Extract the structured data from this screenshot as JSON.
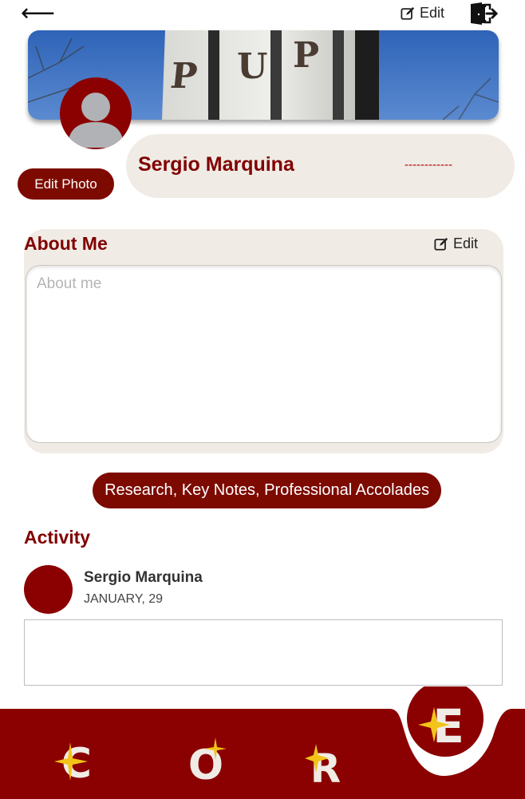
{
  "topbar": {
    "back_icon": "arrow-left-icon",
    "edit_label": "Edit",
    "logout_icon": "logout-door-icon"
  },
  "cover": {
    "sign_letters": [
      "P",
      "U",
      "P"
    ]
  },
  "profile": {
    "name": "Sergio Marquina",
    "secondary": "------------",
    "edit_photo_label": "Edit Photo"
  },
  "about": {
    "title": "About Me",
    "edit_label": "Edit",
    "placeholder": "About me",
    "value": ""
  },
  "research_button_label": "Research, Key Notes, Professional Accolades",
  "activity": {
    "title": "Activity",
    "items": [
      {
        "name": "Sergio Marquina",
        "date": "JANUARY, 29",
        "content": ""
      }
    ]
  },
  "bottom_nav": {
    "items": [
      {
        "letter": "C",
        "icon": "star-c-icon"
      },
      {
        "letter": "O",
        "icon": "star-o-icon"
      },
      {
        "letter": "R",
        "icon": "star-r-icon"
      },
      {
        "letter": "E",
        "icon": "star-e-icon",
        "active": true
      }
    ]
  },
  "colors": {
    "brand": "#800000",
    "button": "#7d0a00",
    "card": "#f0ebe5",
    "star": "#f2c418"
  }
}
